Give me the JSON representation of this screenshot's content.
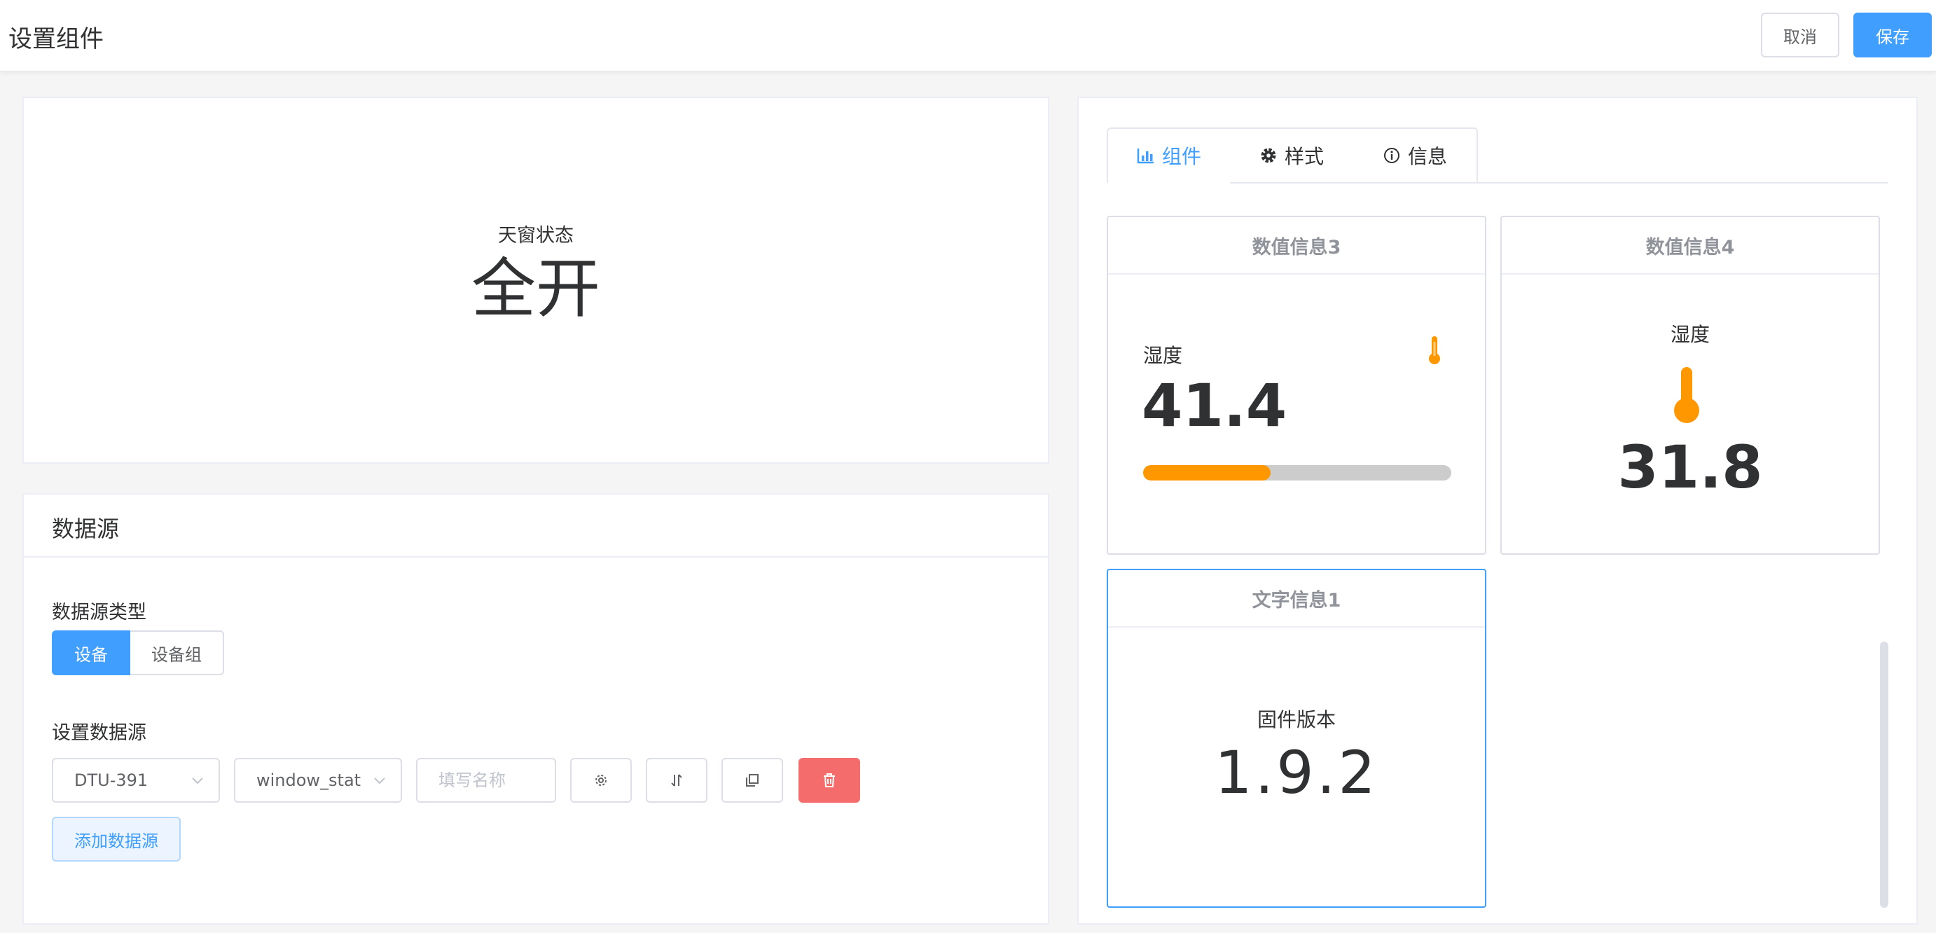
{
  "header": {
    "title": "设置组件",
    "cancel_label": "取消",
    "save_label": "保存"
  },
  "preview": {
    "label": "天窗状态",
    "value": "全开"
  },
  "datasource": {
    "title": "数据源",
    "type_label": "数据源类型",
    "type_options": [
      "设备",
      "设备组"
    ],
    "set_label": "设置数据源",
    "device_select": "DTU-391",
    "field_select": "window_stat",
    "name_placeholder": "填写名称",
    "add_label": "添加数据源"
  },
  "tabs": [
    {
      "label": "组件",
      "icon": "bar-chart-icon"
    },
    {
      "label": "样式",
      "icon": "gear-icon"
    },
    {
      "label": "信息",
      "icon": "info-icon"
    }
  ],
  "cards": [
    {
      "title": "数值信息3",
      "label": "湿度",
      "value": "41.4",
      "progress": 41.4,
      "icon": "thermometer-icon"
    },
    {
      "title": "数值信息4",
      "label": "湿度",
      "value": "31.8",
      "icon": "thermometer-icon"
    },
    {
      "title": "文字信息1",
      "label": "固件版本",
      "value": "1.9.2"
    }
  ],
  "colors": {
    "primary": "#409eff",
    "danger": "#f56c6c",
    "accent": "#ff9800",
    "track": "#cccccc"
  }
}
